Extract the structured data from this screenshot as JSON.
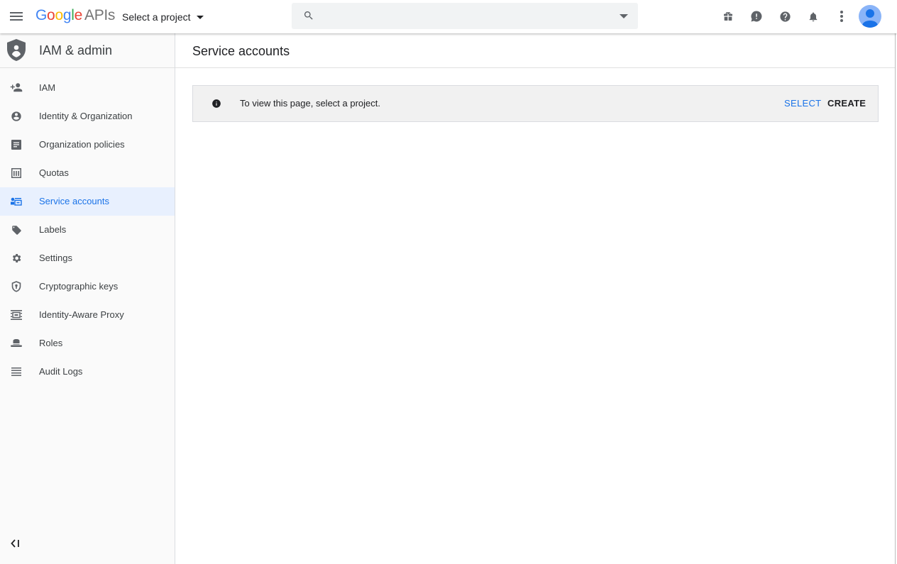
{
  "header": {
    "logo_google": "Google",
    "logo_apis": "APIs",
    "project_label": "Select a project",
    "search_placeholder": "",
    "logo_colors": [
      "#4285F4",
      "#EA4335",
      "#FBBC05",
      "#4285F4",
      "#34A853",
      "#EA4335"
    ],
    "icons": [
      "menu-icon",
      "search-icon",
      "gift-icon",
      "feedback-icon",
      "help-icon",
      "notifications-icon",
      "more-vert-icon",
      "avatar"
    ]
  },
  "sidebar": {
    "title": "IAM & admin",
    "items": [
      {
        "label": "IAM",
        "icon": "person-add-icon",
        "active": false
      },
      {
        "label": "Identity & Organization",
        "icon": "account-circle-icon",
        "active": false
      },
      {
        "label": "Organization policies",
        "icon": "list-alt-icon",
        "active": false
      },
      {
        "label": "Quotas",
        "icon": "quota-icon",
        "active": false
      },
      {
        "label": "Service accounts",
        "icon": "service-account-icon",
        "active": true
      },
      {
        "label": "Labels",
        "icon": "label-icon",
        "active": false
      },
      {
        "label": "Settings",
        "icon": "gear-icon",
        "active": false
      },
      {
        "label": "Cryptographic keys",
        "icon": "key-shield-icon",
        "active": false
      },
      {
        "label": "Identity-Aware Proxy",
        "icon": "proxy-icon",
        "active": false
      },
      {
        "label": "Roles",
        "icon": "hat-icon",
        "active": false
      },
      {
        "label": "Audit Logs",
        "icon": "lines-icon",
        "active": false
      }
    ]
  },
  "main": {
    "title": "Service accounts",
    "banner": {
      "message": "To view this page, select a project.",
      "select_label": "SELECT",
      "create_label": "CREATE"
    }
  },
  "colors": {
    "accent": "#1a73e8",
    "active_bg": "#e8f0fe"
  }
}
